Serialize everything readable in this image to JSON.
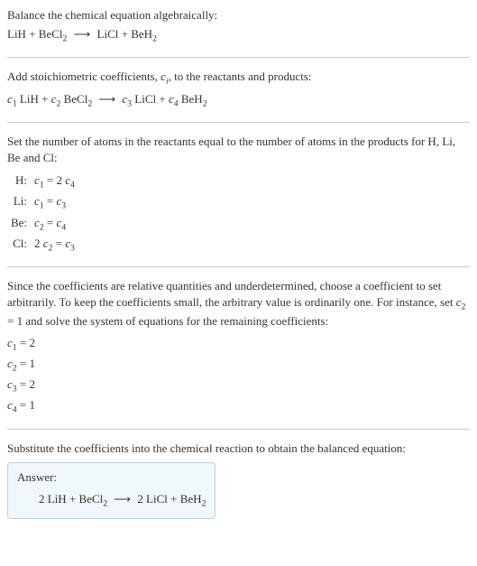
{
  "section1": {
    "title": "Balance the chemical equation algebraically:",
    "eq_lhs1": "LiH",
    "eq_plus1": " + ",
    "eq_lhs2": "BeCl",
    "eq_lhs2_sub": "2",
    "eq_arrow": "⟶",
    "eq_rhs1": "LiCl",
    "eq_plus2": " + ",
    "eq_rhs2": "BeH",
    "eq_rhs2_sub": "2"
  },
  "section2": {
    "title_pre": "Add stoichiometric coefficients, ",
    "title_var": "c",
    "title_var_sub": "i",
    "title_post": ", to the reactants and products:",
    "c1": "c",
    "c1_sub": "1",
    "t1": " LiH",
    "plus1": " + ",
    "c2": "c",
    "c2_sub": "2",
    "t2": " BeCl",
    "t2_sub": "2",
    "arrow": "⟶",
    "c3": "c",
    "c3_sub": "3",
    "t3": " LiCl",
    "plus2": " + ",
    "c4": "c",
    "c4_sub": "4",
    "t4": " BeH",
    "t4_sub": "2"
  },
  "section3": {
    "title": "Set the number of atoms in the reactants equal to the number of atoms in the products for H, Li, Be and Cl:",
    "rows": {
      "h_label": "H:",
      "h_c1": "c",
      "h_c1_sub": "1",
      "h_eq": " = 2 ",
      "h_c4": "c",
      "h_c4_sub": "4",
      "li_label": "Li:",
      "li_c1": "c",
      "li_c1_sub": "1",
      "li_eq": " = ",
      "li_c3": "c",
      "li_c3_sub": "3",
      "be_label": "Be:",
      "be_c2": "c",
      "be_c2_sub": "2",
      "be_eq": " = ",
      "be_c4": "c",
      "be_c4_sub": "4",
      "cl_label": "Cl:",
      "cl_pre": "2 ",
      "cl_c2": "c",
      "cl_c2_sub": "2",
      "cl_eq": " = ",
      "cl_c3": "c",
      "cl_c3_sub": "3"
    }
  },
  "section4": {
    "text_pre": "Since the coefficients are relative quantities and underdetermined, choose a coefficient to set arbitrarily. To keep the coefficients small, the arbitrary value is ordinarily one. For instance, set ",
    "text_var": "c",
    "text_var_sub": "2",
    "text_post": " = 1 and solve the system of equations for the remaining coefficients:",
    "r1_c": "c",
    "r1_sub": "1",
    "r1_val": " = 2",
    "r2_c": "c",
    "r2_sub": "2",
    "r2_val": " = 1",
    "r3_c": "c",
    "r3_sub": "3",
    "r3_val": " = 2",
    "r4_c": "c",
    "r4_sub": "4",
    "r4_val": " = 1"
  },
  "section5": {
    "title": "Substitute the coefficients into the chemical reaction to obtain the balanced equation:",
    "answer_label": "Answer:",
    "eq_pre1": "2 LiH",
    "eq_plus1": " + ",
    "eq_t2": "BeCl",
    "eq_t2_sub": "2",
    "eq_arrow": "⟶",
    "eq_pre3": "2 LiCl",
    "eq_plus2": " + ",
    "eq_t4": "BeH",
    "eq_t4_sub": "2"
  }
}
